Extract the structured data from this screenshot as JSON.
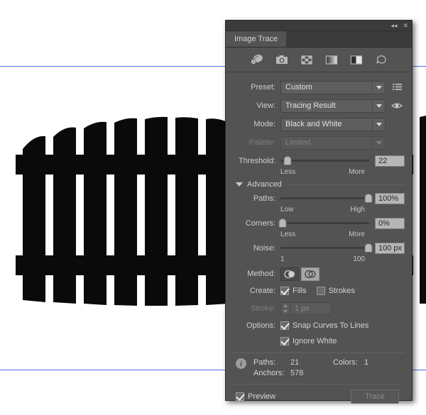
{
  "panel": {
    "tab_label": "Image Trace",
    "collapse_icon": "collapse-panel-icon",
    "close_icon": "close-icon",
    "icons": [
      {
        "name": "auto-color-icon",
        "label": "Auto-Color"
      },
      {
        "name": "high-color-icon",
        "label": "High Color"
      },
      {
        "name": "low-color-icon",
        "label": "Low Color"
      },
      {
        "name": "grayscale-icon",
        "label": "Grayscale"
      },
      {
        "name": "black-and-white-icon",
        "label": "Black and White"
      },
      {
        "name": "outline-icon",
        "label": "Outline"
      }
    ],
    "preset": {
      "label": "Preset:",
      "value": "Custom",
      "menu_icon": "panel-menu-icon"
    },
    "view": {
      "label": "View:",
      "value": "Tracing Result",
      "eye_icon": "eye-icon"
    },
    "mode": {
      "label": "Mode:",
      "value": "Black and White"
    },
    "palette": {
      "label": "Palette:",
      "value": "Limited",
      "disabled": true
    },
    "threshold": {
      "label": "Threshold:",
      "value": "22",
      "percent": 8,
      "scale_min": "Less",
      "scale_max": "More"
    },
    "advanced": {
      "label": "Advanced",
      "expanded": true
    },
    "paths": {
      "label": "Paths:",
      "value": "100%",
      "percent": 100,
      "scale_min": "Low",
      "scale_max": "High"
    },
    "corners": {
      "label": "Corners:",
      "value": "0%",
      "percent": 0,
      "scale_min": "Less",
      "scale_max": "More"
    },
    "noise": {
      "label": "Noise:",
      "value": "100 px",
      "percent": 100,
      "scale_min": "1",
      "scale_max": "100"
    },
    "method": {
      "label": "Method:",
      "abutting_icon": "abutting-method-icon",
      "overlapping_icon": "overlapping-method-icon",
      "selected": "overlapping"
    },
    "create": {
      "label": "Create:",
      "fills_label": "Fills",
      "fills_checked": true,
      "strokes_label": "Strokes",
      "strokes_checked": false
    },
    "stroke": {
      "label": "Stroke:",
      "value": "1 px",
      "disabled": true
    },
    "options": {
      "label": "Options:",
      "snap_label": "Snap Curves To Lines",
      "snap_checked": true,
      "ignore_white_label": "Ignore White",
      "ignore_white_checked": true
    },
    "info": {
      "icon": "info-icon",
      "paths_label": "Paths:",
      "paths_value": "21",
      "colors_label": "Colors:",
      "colors_value": "1",
      "anchors_label": "Anchors:",
      "anchors_value": "578"
    },
    "footer": {
      "preview_label": "Preview",
      "preview_checked": true,
      "trace_label": "Trace",
      "trace_disabled": true
    }
  },
  "canvas": {
    "artwork_name": "traced-fence-artwork",
    "artwork_fill": "#0a0a0a",
    "background": "#ffffff",
    "guide_color": "#4a6ff0"
  }
}
